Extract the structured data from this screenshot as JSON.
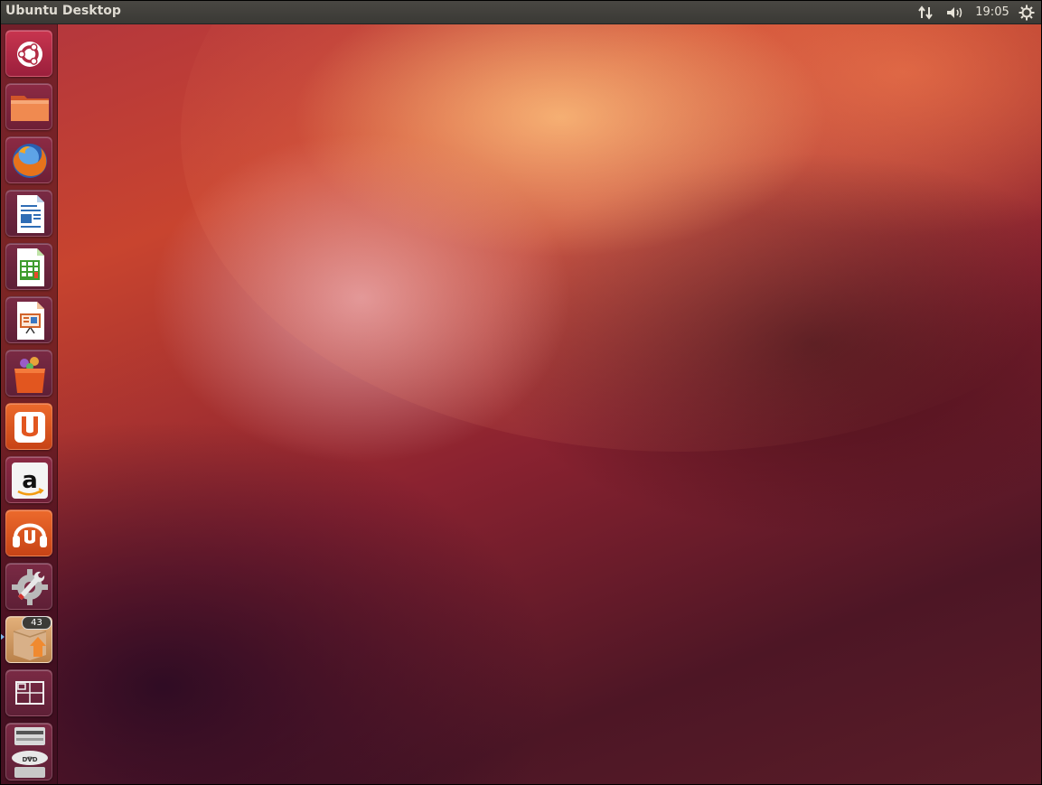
{
  "panel": {
    "title": "Ubuntu Desktop",
    "clock": "19:05",
    "indicators": [
      "network-icon",
      "sound-icon",
      "session-gear-icon"
    ]
  },
  "launcher": {
    "items": [
      {
        "name": "dash-home",
        "icon": "ubuntu-logo-icon",
        "color": "#b22b44"
      },
      {
        "name": "files",
        "icon": "folder-icon",
        "color": "#c55a2c"
      },
      {
        "name": "firefox",
        "icon": "firefox-icon",
        "color": "#8a3050"
      },
      {
        "name": "libreoffice-writer",
        "icon": "writer-document-icon",
        "color": "#6b2a40"
      },
      {
        "name": "libreoffice-calc",
        "icon": "calc-spreadsheet-icon",
        "color": "#5c2a3c"
      },
      {
        "name": "libreoffice-impress",
        "icon": "impress-presentation-icon",
        "color": "#6b2a3c"
      },
      {
        "name": "software-center",
        "icon": "shopping-bag-icon",
        "color": "#7a2a38"
      },
      {
        "name": "ubuntu-one",
        "icon": "ubuntu-one-icon",
        "color": "#d9541e"
      },
      {
        "name": "amazon",
        "icon": "amazon-icon",
        "color": "#7a2a38"
      },
      {
        "name": "ubuntu-one-music",
        "icon": "ubuntu-one-music-icon",
        "color": "#d9541e"
      },
      {
        "name": "system-settings",
        "icon": "settings-wrench-icon",
        "color": "#6b2233"
      },
      {
        "name": "software-updater",
        "icon": "update-package-icon",
        "color": "#c9955a",
        "badge": "43"
      },
      {
        "name": "workspace-switcher",
        "icon": "workspaces-icon",
        "color": "#6b2233"
      },
      {
        "name": "dvd-drive",
        "icon": "dvd-drive-icon",
        "color": "#7a2a38"
      }
    ]
  }
}
